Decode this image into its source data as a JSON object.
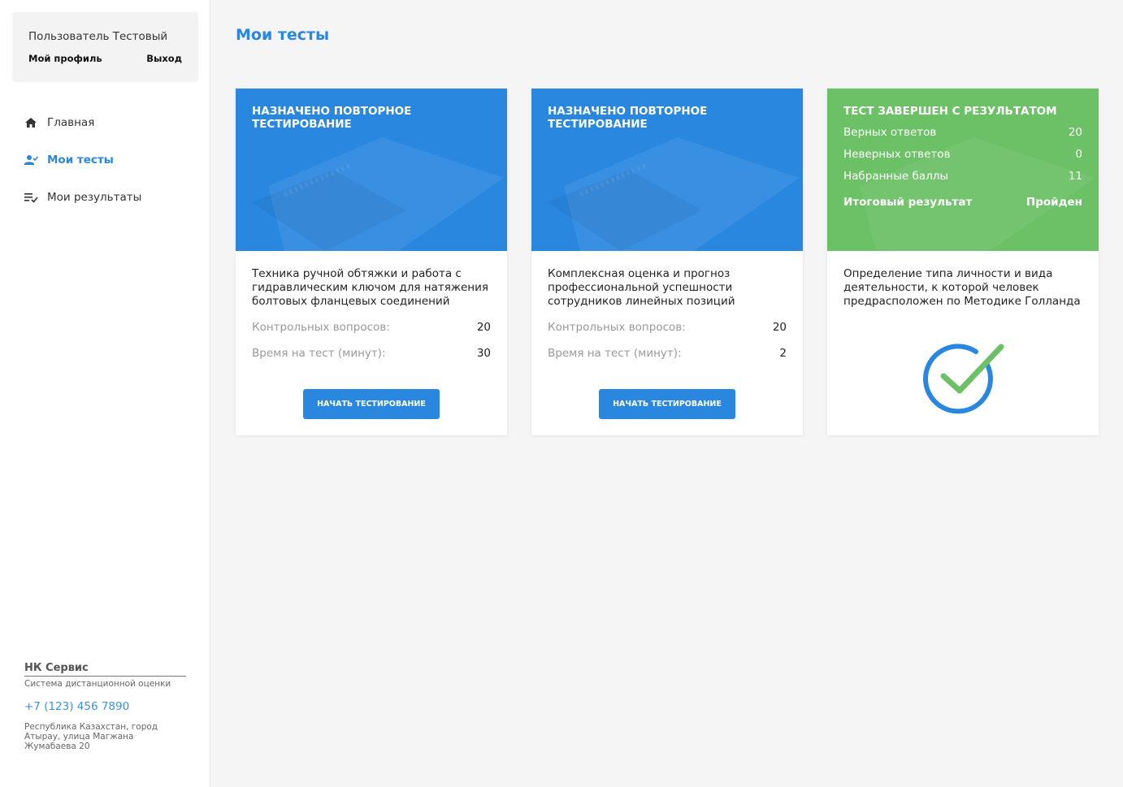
{
  "user": {
    "name": "Пользователь Тестовый",
    "profile_link": "Мой профиль",
    "logout_link": "Выход"
  },
  "nav": {
    "items": [
      {
        "label": "Главная",
        "icon": "home-icon"
      },
      {
        "label": "Мои тесты",
        "icon": "user-check-icon",
        "active": true
      },
      {
        "label": "Мои результаты",
        "icon": "list-check-icon"
      }
    ]
  },
  "footer": {
    "brand": "НК Сервис",
    "subtitle": "Система дистанционной оценки",
    "phone": "+7 (123) 456 7890",
    "address": "Республика Казахстан, город Атырау, улица Магжана Жумабаева 20"
  },
  "page": {
    "title": "Мои тесты"
  },
  "cards": [
    {
      "status": "НАЗНАЧЕНО ПОВТОРНОЕ ТЕСТИРОВАНИЕ",
      "header_color": "#2a87e0",
      "description": "Техника ручной обтяжки и работа с гидравлическим ключом для натяжения болтовых фланцевых соединений",
      "questions_label": "Контрольных вопросов:",
      "questions_value": "20",
      "time_label": "Время на тест (минут):",
      "time_value": "30",
      "button_label": "НАЧАТЬ ТЕСТИРОВАНИЕ"
    },
    {
      "status": "НАЗНАЧЕНО ПОВТОРНОЕ ТЕСТИРОВАНИЕ",
      "header_color": "#2a87e0",
      "description": "Комплексная оценка и прогноз профессиональной успешности сотрудников линейных позиций",
      "questions_label": "Контрольных вопросов:",
      "questions_value": "20",
      "time_label": "Время на тест (минут):",
      "time_value": "2",
      "button_label": "НАЧАТЬ ТЕСТИРОВАНИЕ"
    },
    {
      "status": "ТЕСТ ЗАВЕРШЕН С РЕЗУЛЬТАТОМ",
      "header_color": "#6cc066",
      "correct_label": "Верных ответов",
      "correct_value": "20",
      "wrong_label": "Неверных ответов",
      "wrong_value": "0",
      "score_label": "Набранные баллы",
      "score_value": "11",
      "final_label": "Итоговый результат",
      "final_value": "Пройден",
      "description": "Определение типа личности и вида деятельности, к которой человек предрасположен по Методике Голланда",
      "result_icon": "check-circle-icon"
    }
  ],
  "colors": {
    "accent": "#2a87e0",
    "success": "#6cc066",
    "background": "#f5f5f5"
  }
}
